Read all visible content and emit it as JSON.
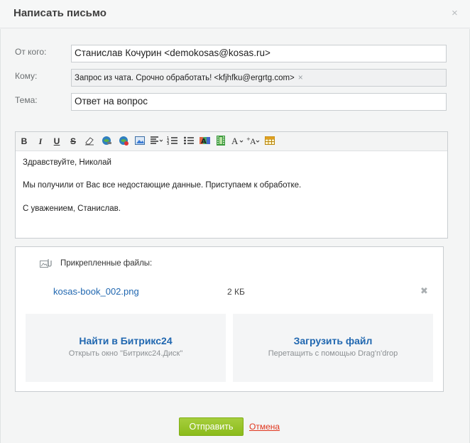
{
  "dialog": {
    "title": "Написать письмо",
    "close_glyph": "×"
  },
  "form": {
    "from_label": "От кого:",
    "from_value": "Станислав Кочурин <demokosas@kosas.ru>",
    "to_label": "Кому:",
    "to_value": "Запрос из чата. Срочно обработать! <kfjhfku@ergrtg.com>",
    "to_remove_glyph": "×",
    "subject_label": "Тема:",
    "subject_value": "Ответ на вопрос"
  },
  "toolbar": {
    "bold": "B",
    "italic": "I",
    "underline": "U",
    "strike": "S"
  },
  "message": {
    "line1": "Здравствуйте, Николай",
    "line2": "Мы получили от Вас все недостающие данные. Приступаем к обработке.",
    "line3": "С уважением, Станислав."
  },
  "attachments": {
    "heading": "Прикрепленные файлы:",
    "file_name": "kosas-book_002.png",
    "file_size": "2 КБ",
    "remove_glyph": "✖",
    "find_title": "Найти в Битрикс24",
    "find_sub": "Открыть окно \"Битрикс24.Диск\"",
    "upload_title": "Загрузить файл",
    "upload_sub": "Перетащить с помощью Drag'n'drop"
  },
  "actions": {
    "send_label": "Отправить",
    "cancel_label": "Отмена"
  },
  "colors": {
    "accent_green": "#8bbb1b",
    "link_blue": "#2067b0",
    "cancel_red": "#e0351d"
  }
}
